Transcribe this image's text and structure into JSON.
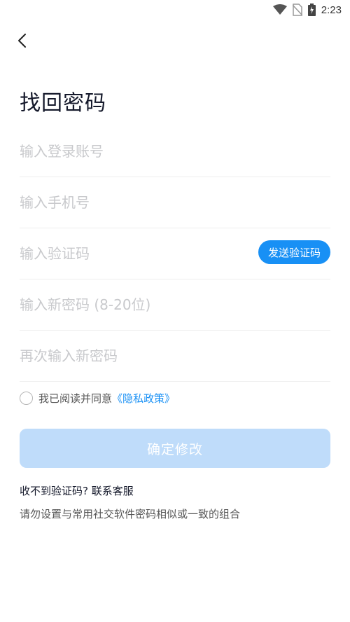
{
  "status_bar": {
    "time": "2:23",
    "icons": [
      "wifi-icon",
      "no-sim-icon",
      "battery-charging-icon"
    ]
  },
  "header": {
    "back_icon": "chevron-left-icon",
    "title": "找回密码"
  },
  "form": {
    "account_placeholder": "输入登录账号",
    "phone_placeholder": "输入手机号",
    "code_placeholder": "输入验证码",
    "send_code_label": "发送验证码",
    "new_password_placeholder": "输入新密码 (8-20位)",
    "confirm_password_placeholder": "再次输入新密码"
  },
  "agreement": {
    "text": "我已阅读并同意",
    "policy_link": "《隐私政策》",
    "checked": false
  },
  "actions": {
    "confirm_label": "确定修改"
  },
  "footer": {
    "contact_text": "收不到验证码? 联系客服",
    "tip_text": "请勿设置与常用社交软件密码相似或一致的组合"
  },
  "colors": {
    "accent": "#1890f5",
    "confirm_disabled_bg": "#bfdcfa",
    "placeholder": "#c8c9cc",
    "title": "#15192b"
  }
}
